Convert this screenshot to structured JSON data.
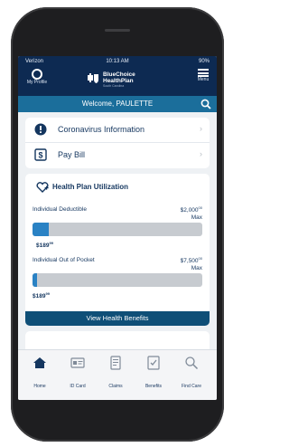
{
  "status_bar": {
    "carrier": "Verizon",
    "time": "10:13 AM",
    "battery": "90%"
  },
  "header": {
    "profile_label": "My Profile",
    "brand_name_line1": "BlueChoice",
    "brand_name_line2": "HealthPlan",
    "brand_subtitle": "South Carolina",
    "menu_label": "Menu",
    "welcome_text": "Welcome, PAULETTE"
  },
  "quick_links": [
    {
      "label": "Coronavirus Information",
      "icon": "info-icon"
    },
    {
      "label": "Pay Bill",
      "icon": "dollar-icon"
    }
  ],
  "utilization": {
    "title": "Health Plan Utilization",
    "deductible": {
      "label": "Individual Deductible",
      "max_amount": "$2,000",
      "max_cents": "00",
      "max_label": "Max",
      "spent": "$189",
      "spent_cents": "99",
      "progress": 0.095
    },
    "out_of_pocket": {
      "label": "Individual Out of Pocket",
      "max_amount": "$7,500",
      "max_cents": "00",
      "max_label": "Max",
      "spent": "$189",
      "spent_cents": "99",
      "progress": 0.025
    },
    "button_label": "View Health Benefits"
  },
  "tabs": [
    {
      "label": "Home",
      "icon": "home-icon",
      "active": true
    },
    {
      "label": "ID Card",
      "icon": "id-card-icon",
      "active": false
    },
    {
      "label": "Claims",
      "icon": "claims-icon",
      "active": false
    },
    {
      "label": "Benefits",
      "icon": "benefits-icon",
      "active": false
    },
    {
      "label": "Find Care",
      "icon": "search-icon",
      "active": false
    }
  ],
  "colors": {
    "navy": "#0d2a52",
    "welcome_bar": "#1b6e9b",
    "progress": "#2a82c4",
    "button": "#0f4f77"
  }
}
